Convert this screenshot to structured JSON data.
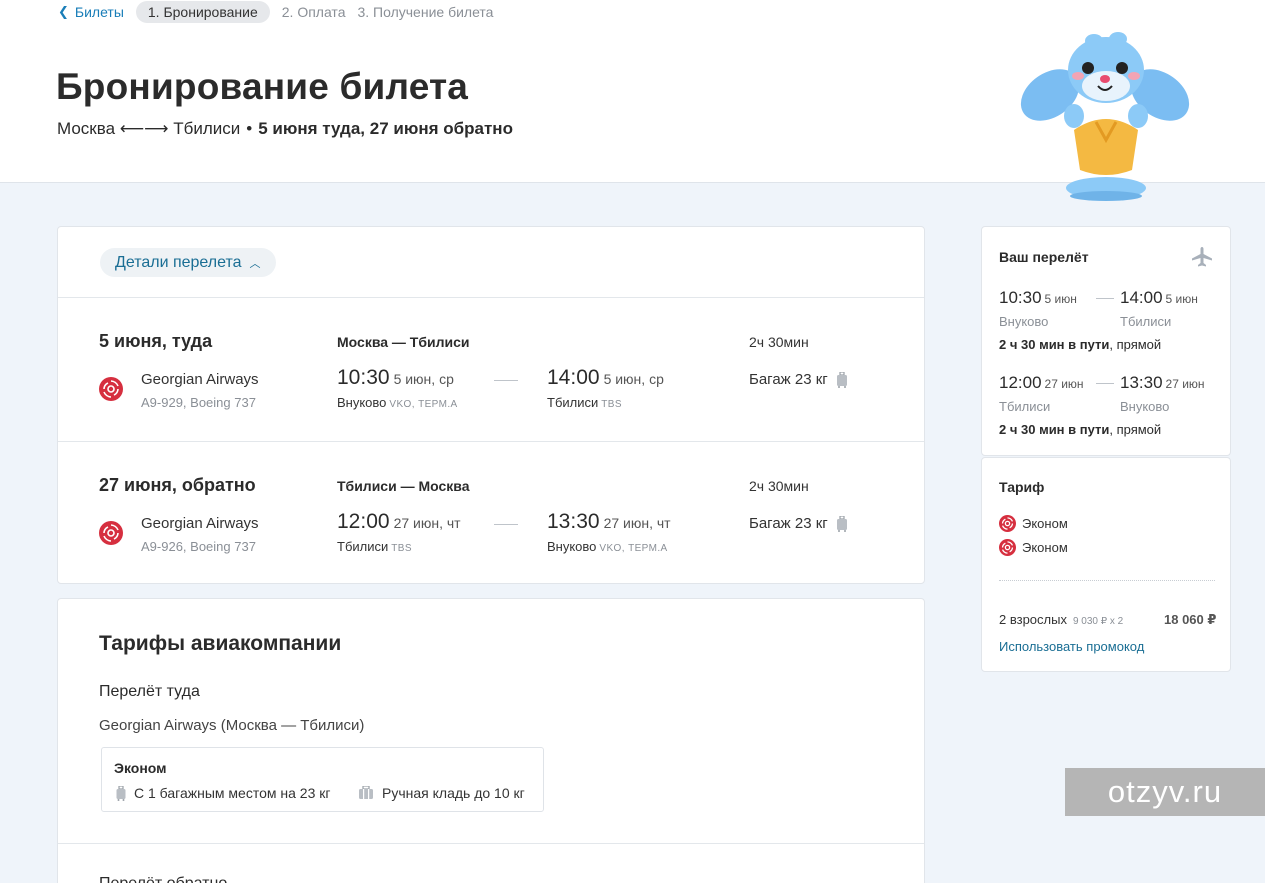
{
  "breadcrumbs": {
    "back": "Билеты",
    "active": "1. Бронирование",
    "step2": "2. Оплата",
    "step3": "3. Получение билета"
  },
  "header": {
    "title": "Бронирование билета",
    "route": "Москва ⟵⟶ Тбилиси",
    "dates": "5 июня туда, 27 июня обратно"
  },
  "details": {
    "toggle_label": "Детали перелета",
    "segments": [
      {
        "date": "5 июня, туда",
        "route": "Москва — Тбилиси",
        "duration": "2ч 30мин",
        "airline": "Georgian Airways",
        "flight": "A9-929, Boeing 737",
        "dep_time": "10:30",
        "dep_date": "5 июн, ср",
        "dep_airport": "Внуково",
        "dep_code": "VKO, ТЕРМ.A",
        "arr_time": "14:00",
        "arr_date": "5 июн, ср",
        "arr_airport": "Тбилиси",
        "arr_code": "TBS",
        "baggage": "Багаж 23 кг"
      },
      {
        "date": "27 июня, обратно",
        "route": "Тбилиси — Москва",
        "duration": "2ч 30мин",
        "airline": "Georgian Airways",
        "flight": "A9-926, Boeing 737",
        "dep_time": "12:00",
        "dep_date": "27 июн, чт",
        "dep_airport": "Тбилиси",
        "dep_code": "TBS",
        "arr_time": "13:30",
        "arr_date": "27 июн, чт",
        "arr_airport": "Внуково",
        "arr_code": "VKO, ТЕРМ.A",
        "baggage": "Багаж 23 кг"
      }
    ]
  },
  "tariffs": {
    "title": "Тарифы авиакомпании",
    "outbound_label": "Перелёт туда",
    "outbound_airline": "Georgian Airways (Москва — Тбилиси)",
    "fare_name": "Эконом",
    "fare_baggage": "С 1 багажным местом на 23 кг",
    "fare_hand": "Ручная кладь до 10 кг",
    "return_label": "Перелёт обратно"
  },
  "summary": {
    "title": "Ваш перелёт",
    "legs": [
      {
        "dep_time": "10:30",
        "dep_date": "5 июн",
        "dep_airport": "Внуково",
        "arr_time": "14:00",
        "arr_date": "5 июн",
        "arr_airport": "Тбилиси",
        "duration": "2 ч 30 мин в пути",
        "type": ", прямой"
      },
      {
        "dep_time": "12:00",
        "dep_date": "27 июн",
        "dep_airport": "Тбилиси",
        "arr_time": "13:30",
        "arr_date": "27 июн",
        "arr_airport": "Внуково",
        "duration": "2 ч 30 мин в пути",
        "type": ", прямой"
      }
    ]
  },
  "fare_summary": {
    "title": "Тариф",
    "fares": [
      "Эконом",
      "Эконом"
    ],
    "passengers": "2 взрослых",
    "price_each": "9 030 ₽ x 2",
    "total": "18 060 ₽",
    "promo": "Использовать промокод"
  },
  "watermark": "otzyv.ru",
  "colors": {
    "accent": "#1a6e94",
    "airline_logo": "#d62f3f",
    "background": "#eff4fa"
  }
}
